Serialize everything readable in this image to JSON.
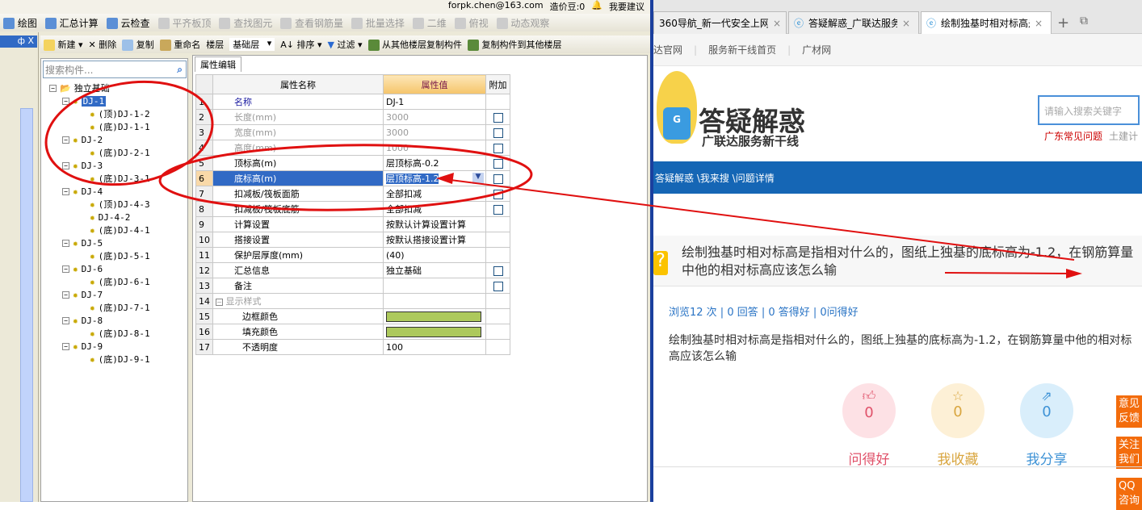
{
  "app": {
    "account": {
      "email": "forpk.chen@163.com",
      "beans": "造价豆:0",
      "suggest": "我要建议"
    },
    "toolbar1": [
      {
        "label": "绘图",
        "icon": "draw-icon",
        "enabled": true
      },
      {
        "label": "汇总计算",
        "icon": "sigma-icon",
        "enabled": true
      },
      {
        "label": "云检查",
        "icon": "cloud-check-icon",
        "enabled": true
      },
      {
        "label": "平齐板顶",
        "icon": "align-icon",
        "enabled": false
      },
      {
        "label": "查找图元",
        "icon": "binoculars-icon",
        "enabled": false
      },
      {
        "label": "查看钢筋量",
        "icon": "rebar-icon",
        "enabled": false
      },
      {
        "label": "批量选择",
        "icon": "batch-select-icon",
        "enabled": false
      },
      {
        "label": "二维",
        "icon": "2d-icon",
        "enabled": false
      },
      {
        "label": "俯视",
        "icon": "top-view-icon",
        "enabled": false
      },
      {
        "label": "动态观察",
        "icon": "orbit-icon",
        "enabled": false
      }
    ],
    "toolbar2": {
      "new": "新建",
      "delete": "删除",
      "copy": "复制",
      "rename": "重命名",
      "floor_label": "楼层",
      "floor_value": "基础层",
      "sort": "排序",
      "filter": "过滤",
      "copy_from": "从其他楼层复制构件",
      "copy_to": "复制构件到其他楼层"
    },
    "dock_header": "ф X",
    "search_placeholder": "搜索构件...",
    "tree": {
      "root": "独立基础",
      "groups": [
        {
          "name": "DJ-1",
          "children": [
            "(顶)DJ-1-2",
            "(底)DJ-1-1"
          ]
        },
        {
          "name": "DJ-2",
          "children": [
            "(底)DJ-2-1"
          ]
        },
        {
          "name": "DJ-3",
          "children": [
            "(底)DJ-3-1"
          ]
        },
        {
          "name": "DJ-4",
          "children": [
            "(顶)DJ-4-3",
            "DJ-4-2",
            "(底)DJ-4-1"
          ]
        },
        {
          "name": "DJ-5",
          "children": [
            "(底)DJ-5-1"
          ]
        },
        {
          "name": "DJ-6",
          "children": [
            "(底)DJ-6-1"
          ]
        },
        {
          "name": "DJ-7",
          "children": [
            "(底)DJ-7-1"
          ]
        },
        {
          "name": "DJ-8",
          "children": [
            "(底)DJ-8-1"
          ]
        },
        {
          "name": "DJ-9",
          "children": [
            "(底)DJ-9-1"
          ]
        }
      ],
      "selected": "DJ-1"
    },
    "props_tab": "属性编辑",
    "props_headers": [
      "属性名称",
      "属性值",
      "附加"
    ],
    "props": [
      {
        "n": "1",
        "name": "名称",
        "value": "DJ-1",
        "cb": false
      },
      {
        "n": "2",
        "name": "长度(mm)",
        "value": "3000",
        "cb": true,
        "grey": true
      },
      {
        "n": "3",
        "name": "宽度(mm)",
        "value": "3000",
        "cb": true,
        "grey": true
      },
      {
        "n": "4",
        "name": "高度(mm)",
        "value": "1000",
        "cb": true,
        "grey": true
      },
      {
        "n": "5",
        "name": "顶标高(m)",
        "value": "层顶标高-0.2",
        "cb": true
      },
      {
        "n": "6",
        "name": "底标高(m)",
        "value": "层顶标高-1.2",
        "cb": true,
        "selected": true
      },
      {
        "n": "7",
        "name": "扣减板/筏板面筋",
        "value": "全部扣减",
        "cb": true
      },
      {
        "n": "8",
        "name": "扣减板/筏板底筋",
        "value": "全部扣减",
        "cb": true
      },
      {
        "n": "9",
        "name": "计算设置",
        "value": "按默认计算设置计算",
        "cb": false
      },
      {
        "n": "10",
        "name": "搭接设置",
        "value": "按默认搭接设置计算",
        "cb": false
      },
      {
        "n": "11",
        "name": "保护层厚度(mm)",
        "value": "(40)",
        "cb": false
      },
      {
        "n": "12",
        "name": "汇总信息",
        "value": "独立基础",
        "cb": true
      },
      {
        "n": "13",
        "name": "备注",
        "value": "",
        "cb": true
      },
      {
        "n": "14",
        "name": "显示样式",
        "value": "",
        "cb": false,
        "group": true
      },
      {
        "n": "15",
        "name": "边框颜色",
        "value": "",
        "cb": false,
        "swatch": "#adc95c"
      },
      {
        "n": "16",
        "name": "填充颜色",
        "value": "",
        "cb": false,
        "swatch": "#adc95c"
      },
      {
        "n": "17",
        "name": "不透明度",
        "value": "100",
        "cb": false
      }
    ]
  },
  "browser": {
    "tabs": [
      {
        "title": "360导航_新一代安全上网导"
      },
      {
        "title": "答疑解惑_广联达服务新干"
      },
      {
        "title": "绘制独基时相对标高是指相对",
        "active": true
      }
    ],
    "links": [
      "达官网",
      "|",
      "服务新干线首页",
      "|",
      "广材网"
    ],
    "logo_title": "答疑解惑",
    "logo_sub": "广联达服务新干线",
    "search_placeholder": "请输入搜索关键字",
    "hot": [
      "广东常见问题",
      "土建计"
    ],
    "breadcrumb": "答疑解惑 \\我来搜 \\问题详情",
    "question_title": "绘制独基时相对标高是指相对什么的，图纸上独基的底标高为-1.2，在钢筋算量中他的相对标高应该怎么输",
    "stats": "浏览12 次 | 0 回答 | 0 答得好 | 0问得好",
    "body": "绘制独基时相对标高是指相对什么的，图纸上独基的底标高为-1.2，在钢筋算量中他的相对标高应该怎么输",
    "actions": [
      {
        "label": "问得好",
        "count": "0",
        "icon": "thumbs-up-icon",
        "color": "#e0526a",
        "bg": "#fde1e5"
      },
      {
        "label": "我收藏",
        "count": "0",
        "icon": "star-icon",
        "color": "#d9a640",
        "bg": "#fdf0d6"
      },
      {
        "label": "我分享",
        "count": "0",
        "icon": "share-icon",
        "color": "#3f93d6",
        "bg": "#d9eefb"
      }
    ],
    "side": [
      "意见反馈",
      "关注我们",
      "QQ咨询"
    ],
    "accent": "#1566b5"
  }
}
